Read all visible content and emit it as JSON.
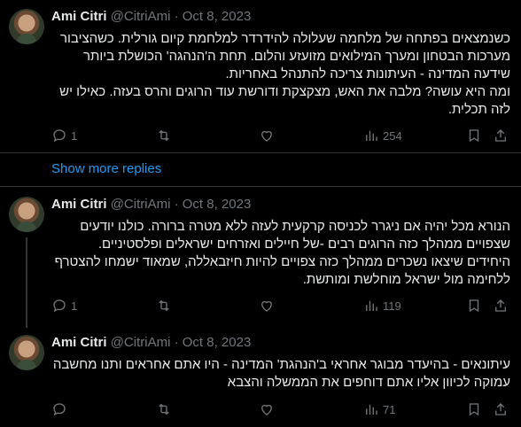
{
  "show_more_label": "Show more replies",
  "tweets": [
    {
      "name": "Ami Citri",
      "handle": "@CitriAmi",
      "date": "· Oct 8, 2023",
      "lines": [
        "כשנמצאים בפתחה של מלחמה שעלולה להידרדר למלחמת קיום גורלית. כשהציבור",
        "מערכות הבטחון ומערך המילואים מזועזע והלום. תחת ה'הנהגה' הכושלת ביותר",
        "שידעה המדינה - העיתונות צריכה להתנהל באחריות.",
        "ומה היא עושה? מלבה את האש, מצקצקת ודורשת עוד הרוגים והרס בעזה. כאילו יש",
        "לזה תכלית."
      ],
      "replies": "1",
      "views": "254"
    },
    {
      "name": "Ami Citri",
      "handle": "@CitriAmi",
      "date": "· Oct 8, 2023",
      "lines": [
        "הנורא מכל יהיה אם ניגרר לכניסה קרקעית לעזה ללא מטרה ברורה. כולנו יודעים",
        "שצפויים ממהלך כזה הרוגים רבים -של חיילים ואזרחים ישראלים ופלסטיניים.",
        "היחידים שיצאו נשכרים ממהלך כזה צפויים להיות חיזבאללה, שמאוד ישמחו להצטרף",
        "ללחימה מול ישראל מוחלשת ומותשת."
      ],
      "replies": "1",
      "views": "119"
    },
    {
      "name": "Ami Citri",
      "handle": "@CitriAmi",
      "date": "· Oct 8, 2023",
      "lines": [
        "עיתונאים - בהיעדר מבוגר אחראי ב'הנהגת' המדינה - היו אתם אחראים ותנו מחשבה",
        "עמוקה לכיוון אליו אתם דוחפים את הממשלה והצבא"
      ],
      "replies": "",
      "views": "71"
    }
  ]
}
